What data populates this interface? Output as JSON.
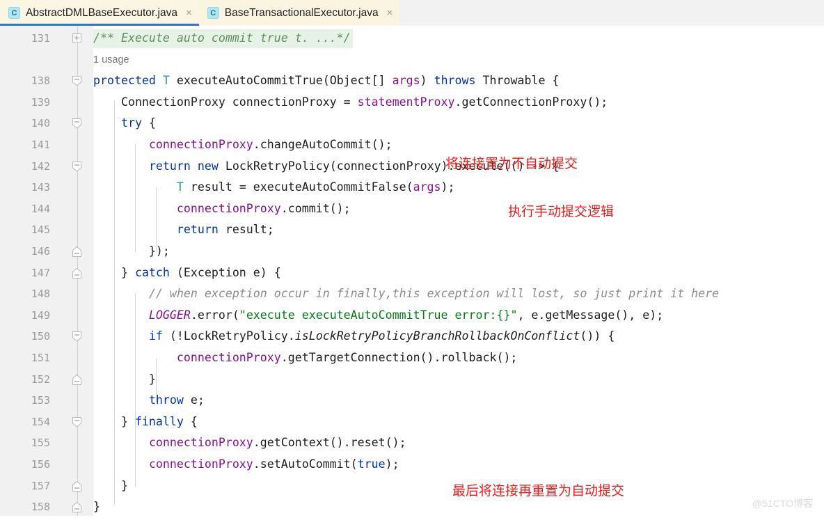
{
  "window": {
    "watermark": "@51CTO博客"
  },
  "tabs": [
    {
      "label": "AbstractDMLBaseExecutor.java",
      "icon": "java-class-icon",
      "icon_letter": "C",
      "close": "×",
      "active": true
    },
    {
      "label": "BaseTransactionalExecutor.java",
      "icon": "java-class-icon",
      "icon_letter": "C",
      "close": "×",
      "active": false
    }
  ],
  "editor": {
    "usage_hint": "1 usage",
    "lines": [
      {
        "number": "131",
        "fold": "plus",
        "text": "/** Execute auto commit true t. ...*/"
      },
      {
        "number": "",
        "fold": "none",
        "text": "1 usage"
      },
      {
        "number": "138",
        "fold": "minus",
        "text": "protected T executeAutoCommitTrue(Object[] args) throws Throwable {"
      },
      {
        "number": "139",
        "fold": "none",
        "text": "    ConnectionProxy connectionProxy = statementProxy.getConnectionProxy();"
      },
      {
        "number": "140",
        "fold": "minus",
        "text": "    try {"
      },
      {
        "number": "141",
        "fold": "none",
        "text": "        connectionProxy.changeAutoCommit();"
      },
      {
        "number": "142",
        "fold": "minus",
        "text": "        return new LockRetryPolicy(connectionProxy).execute(() -> {"
      },
      {
        "number": "143",
        "fold": "none",
        "text": "            T result = executeAutoCommitFalse(args);"
      },
      {
        "number": "144",
        "fold": "none",
        "text": "            connectionProxy.commit();"
      },
      {
        "number": "145",
        "fold": "none",
        "text": "            return result;"
      },
      {
        "number": "146",
        "fold": "end",
        "text": "        });"
      },
      {
        "number": "147",
        "fold": "end",
        "text": "    } catch (Exception e) {"
      },
      {
        "number": "148",
        "fold": "none",
        "text": "        // when exception occur in finally,this exception will lost, so just print it here"
      },
      {
        "number": "149",
        "fold": "none",
        "text": "        LOGGER.error(\"execute executeAutoCommitTrue error:{}\", e.getMessage(), e);"
      },
      {
        "number": "150",
        "fold": "minus",
        "text": "        if (!LockRetryPolicy.isLockRetryPolicyBranchRollbackOnConflict()) {"
      },
      {
        "number": "151",
        "fold": "none",
        "text": "            connectionProxy.getTargetConnection().rollback();"
      },
      {
        "number": "152",
        "fold": "end",
        "text": "        }"
      },
      {
        "number": "153",
        "fold": "none",
        "text": "        throw e;"
      },
      {
        "number": "154",
        "fold": "minus",
        "text": "    } finally {"
      },
      {
        "number": "155",
        "fold": "none",
        "text": "        connectionProxy.getContext().reset();"
      },
      {
        "number": "156",
        "fold": "none",
        "text": "        connectionProxy.setAutoCommit(true);"
      },
      {
        "number": "157",
        "fold": "end",
        "text": "    }"
      },
      {
        "number": "158",
        "fold": "end",
        "text": "}"
      }
    ]
  },
  "annotations": [
    {
      "text": "将连接置为不自动提交",
      "line": "141"
    },
    {
      "text": "执行手动提交逻辑",
      "line": "143"
    },
    {
      "text": "最后将连接再重置为自动提交",
      "line": "156"
    }
  ],
  "colors": {
    "keyword": "#0033b3",
    "type": "#20999d",
    "field": "#871094",
    "string": "#067d17",
    "comment": "#8c8c8c",
    "doc_comment": "#5f8c5f",
    "annotation_red": "#ef1c1c",
    "tab_active_underline": "#3573c7",
    "gutter_bg": "#f1f1f1"
  }
}
